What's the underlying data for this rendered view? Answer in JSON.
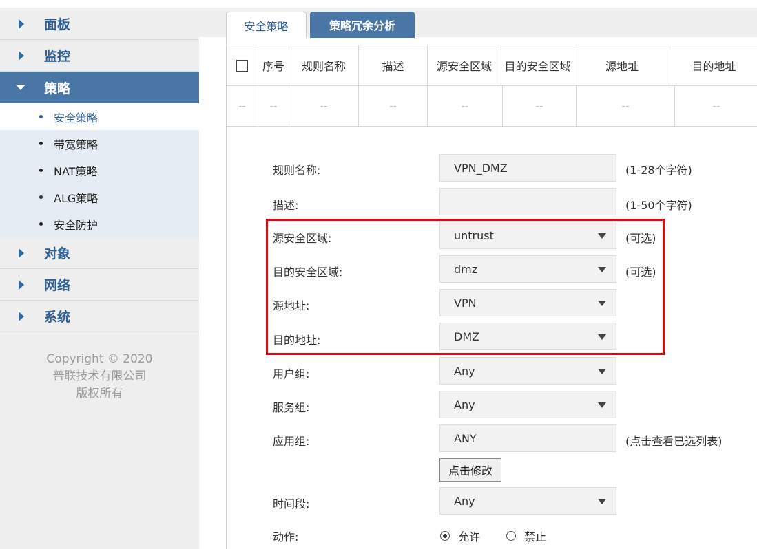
{
  "sidebar": {
    "menu": [
      {
        "label": "面板"
      },
      {
        "label": "监控"
      },
      {
        "label": "策略"
      },
      {
        "label": "对象"
      },
      {
        "label": "网络"
      },
      {
        "label": "系统"
      }
    ],
    "active_menu": "策略",
    "submenu": [
      {
        "label": "安全策略"
      },
      {
        "label": "带宽策略"
      },
      {
        "label": "NAT策略"
      },
      {
        "label": "ALG策略"
      },
      {
        "label": "安全防护"
      }
    ],
    "selected_submenu": "安全策略",
    "copyright": {
      "line1": "Copyright © 2020",
      "line2": "普联技术有限公司",
      "line3": "版权所有"
    }
  },
  "tabs": [
    {
      "label": "安全策略"
    },
    {
      "label": "策略冗余分析"
    }
  ],
  "table": {
    "headers": [
      "序号",
      "规则名称",
      "描述",
      "源安全区域",
      "目的安全区域",
      "源地址",
      "目的地址"
    ],
    "empty_row": [
      "--",
      "--",
      "--",
      "--",
      "--",
      "--",
      "--",
      "--"
    ]
  },
  "form": {
    "rule_name": {
      "label": "规则名称:",
      "value": "VPN_DMZ",
      "hint": "(1-28个字符)"
    },
    "description": {
      "label": "描述:",
      "value": "",
      "hint": "(1-50个字符)"
    },
    "src_zone": {
      "label": "源安全区域:",
      "value": "untrust",
      "hint": "(可选)"
    },
    "dst_zone": {
      "label": "目的安全区域:",
      "value": "dmz",
      "hint": "(可选)"
    },
    "src_addr": {
      "label": "源地址:",
      "value": "VPN"
    },
    "dst_addr": {
      "label": "目的地址:",
      "value": "DMZ"
    },
    "user_group": {
      "label": "用户组:",
      "value": "Any"
    },
    "service_group": {
      "label": "服务组:",
      "value": "Any"
    },
    "app_group": {
      "label": "应用组:",
      "value": "ANY",
      "hint": "(点击查看已选列表)"
    },
    "modify_button": "点击修改",
    "time_range": {
      "label": "时间段:",
      "value": "Any"
    },
    "action": {
      "label": "动作:",
      "allow": "允许",
      "deny": "禁止",
      "selected": "允许"
    }
  },
  "colors": {
    "accent": "#4a76a6",
    "sidebar_bg": "#eeeeee",
    "submenu_bg": "#e5ecf3",
    "highlight": "#e0060d"
  }
}
